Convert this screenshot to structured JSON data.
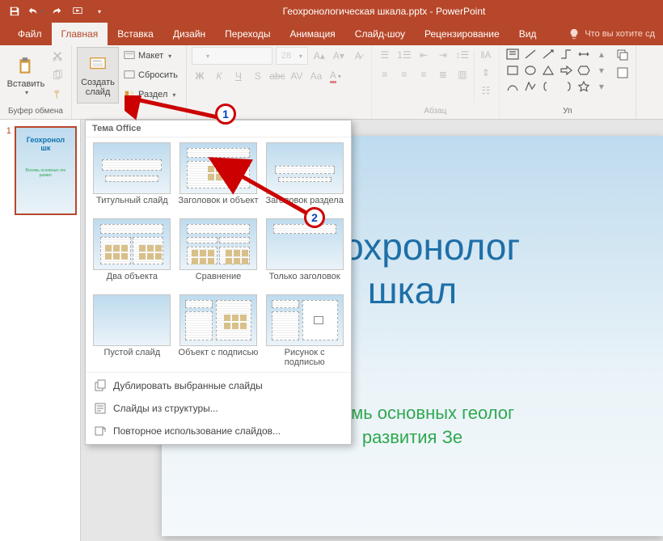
{
  "titlebar": {
    "title": "Геохронологическая шкала.pptx - PowerPoint"
  },
  "tabs": {
    "file": "Файл",
    "home": "Главная",
    "insert": "Вставка",
    "design": "Дизайн",
    "transitions": "Переходы",
    "animations": "Анимация",
    "slideshow": "Слайд-шоу",
    "review": "Рецензирование",
    "view": "Вид",
    "tellme": "Что вы хотите сд"
  },
  "ribbon": {
    "clipboard": {
      "paste": "Вставить",
      "label": "Буфер обмена"
    },
    "slides": {
      "new_slide": "Создать\nслайд",
      "layout": "Макет",
      "reset": "Сбросить",
      "section": "Раздел"
    },
    "font": {
      "size": "28"
    },
    "paragraph": {
      "label": "Абзац"
    },
    "arrange": {
      "label": "Уп"
    }
  },
  "gallery": {
    "header": "Тема Office",
    "layouts": [
      "Титульный слайд",
      "Заголовок и объект",
      "Заголовок раздела",
      "Два объекта",
      "Сравнение",
      "Только заголовок",
      "Пустой слайд",
      "Объект с подписью",
      "Рисунок с подписью"
    ],
    "footer": {
      "duplicate": "Дублировать выбранные слайды",
      "outline": "Слайды из структуры...",
      "reuse": "Повторное использование слайдов..."
    }
  },
  "thumbnail": {
    "num": "1",
    "title": "Геохронол\nшк",
    "sub": "Восемь основных гео\nразвит"
  },
  "slide": {
    "title": "Геохронолог\nшкал",
    "sub": "Восемь основных геолог\nразвития Зе"
  },
  "callouts": {
    "one": "1",
    "two": "2"
  }
}
